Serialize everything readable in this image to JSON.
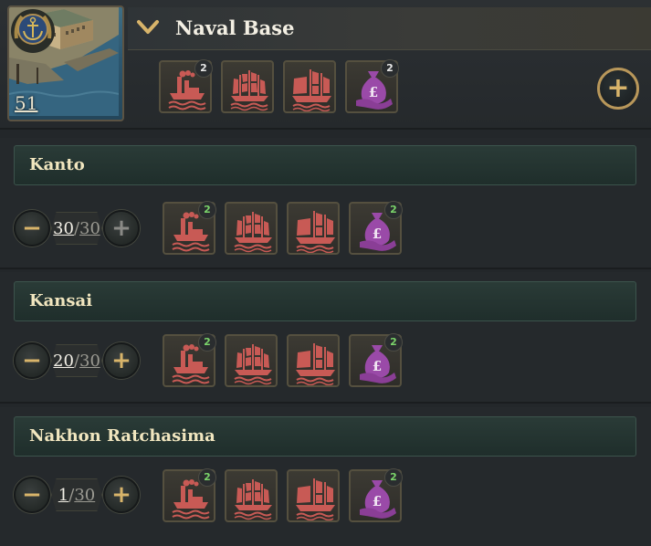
{
  "building": {
    "title": "Naval Base",
    "level": "51",
    "icons": [
      {
        "name": "factory-ship-icon",
        "count": "2"
      },
      {
        "name": "frigate-ship-icon",
        "count": ""
      },
      {
        "name": "man-o-war-ship-icon",
        "count": ""
      },
      {
        "name": "money-bag-icon",
        "count": "2"
      }
    ]
  },
  "regions": [
    {
      "name": "Kanto",
      "current": "30",
      "max": "30",
      "plus_disabled": true,
      "icons": [
        {
          "count": "2"
        },
        {
          "count": ""
        },
        {
          "count": ""
        },
        {
          "count": "2"
        }
      ]
    },
    {
      "name": "Kansai",
      "current": "20",
      "max": "30",
      "plus_disabled": false,
      "icons": [
        {
          "count": "2"
        },
        {
          "count": ""
        },
        {
          "count": ""
        },
        {
          "count": "2"
        }
      ]
    },
    {
      "name": "Nakhon Ratchasima",
      "current": "1",
      "max": "30",
      "plus_disabled": false,
      "icons": [
        {
          "count": "2"
        },
        {
          "count": ""
        },
        {
          "count": ""
        },
        {
          "count": "2"
        }
      ]
    }
  ],
  "controls": {
    "minus_symbol": "−",
    "plus_symbol": "+",
    "separator": "/"
  },
  "colors": {
    "accent_gold": "#d8b46a",
    "ship_red": "#c85a55",
    "money_purple": "#9a4aa8",
    "count_green": "#7ad36a"
  }
}
